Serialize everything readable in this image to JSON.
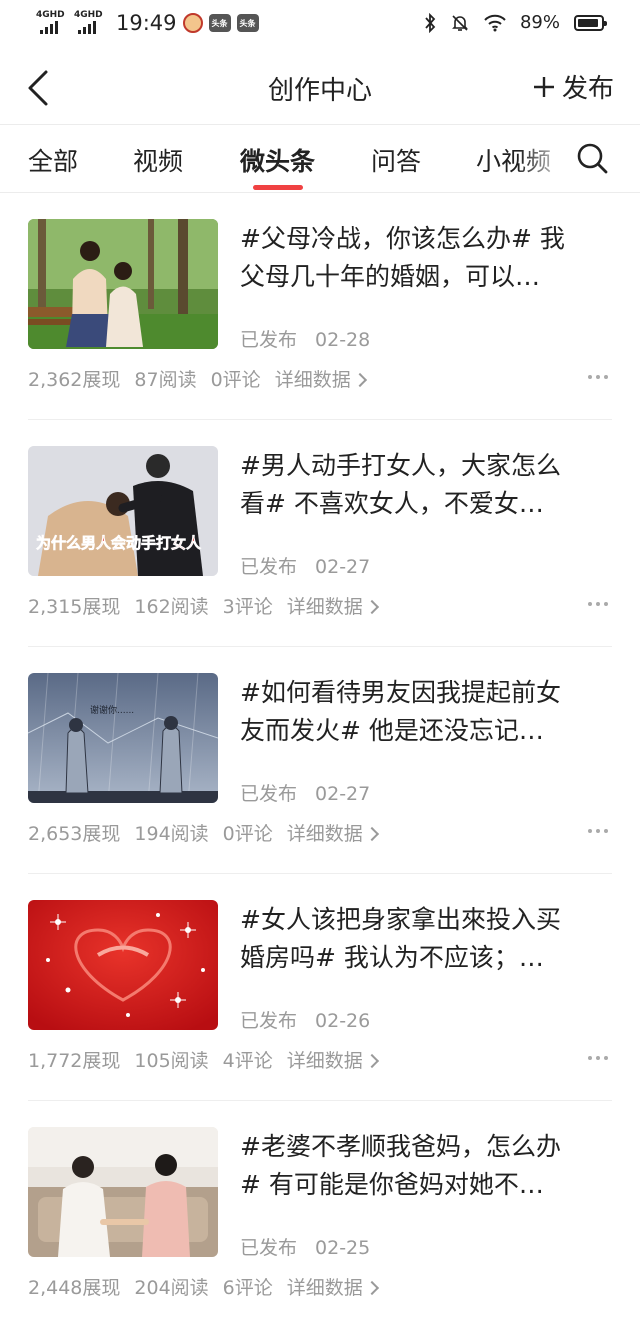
{
  "status_bar": {
    "network1": "4GHD",
    "network2": "4GHD",
    "time": "19:49",
    "app_badge1": "头条",
    "app_badge2": "头条",
    "battery": "89%",
    "battery_level": 0.89,
    "icons": [
      "signal-icon",
      "signal-icon",
      "app-notification-icon",
      "toutiao-icon",
      "toutiao-icon",
      "bluetooth-icon",
      "mute-icon",
      "wifi-icon",
      "battery-icon"
    ]
  },
  "header": {
    "title": "创作中心",
    "publish_label": "发布",
    "icons": [
      "back-icon",
      "plus-icon"
    ]
  },
  "tabs": [
    {
      "label": "全部"
    },
    {
      "label": "视频"
    },
    {
      "label": "微头条"
    },
    {
      "label": "问答"
    },
    {
      "label": "小视频"
    }
  ],
  "active_tab": "微头条",
  "colors": {
    "accent": "#f04142",
    "text": "#222222",
    "muted": "#9a9a9a"
  },
  "posts": [
    {
      "title_line1": "#父母冷战，你该怎么办# 我",
      "title_line2": "父母几十年的婚姻，可以…",
      "status": "已发布",
      "date": "02-28",
      "views": "2,362展现",
      "reads": "87阅读",
      "comments": "0评论",
      "details": "详细数据",
      "image": "mother-daughter-park-photo"
    },
    {
      "title_line1": "#男人动手打女人，大家怎么",
      "title_line2": "看# 不喜欢女人，不爱女…",
      "status": "已发布",
      "date": "02-27",
      "views": "2,315展现",
      "reads": "162阅读",
      "comments": "3评论",
      "details": "详细数据",
      "image": "couple-argument-photo",
      "image_caption": "为什么男人会动手打女人"
    },
    {
      "title_line1": "#如何看待男友因我提起前女",
      "title_line2": "友而发火# 他是还没忘记…",
      "status": "已发布",
      "date": "02-27",
      "views": "2,653展现",
      "reads": "194阅读",
      "comments": "0评论",
      "details": "详细数据",
      "image": "anime-couple-rain-illustration",
      "image_caption": "谢谢你......"
    },
    {
      "title_line1": "#女人该把身家拿出來投入买",
      "title_line2": "婚房吗# 我认为不应该；…",
      "status": "已发布",
      "date": "02-26",
      "views": "1,772展现",
      "reads": "105阅读",
      "comments": "4评论",
      "details": "详细数据",
      "image": "red-heart-sparkle-graphic"
    },
    {
      "title_line1": "#老婆不孝顺我爸妈，怎么办",
      "title_line2": "# 有可能是你爸妈对她不…",
      "status": "已发布",
      "date": "02-25",
      "views": "2,448展现",
      "reads": "204阅读",
      "comments": "6评论",
      "details": "详细数据",
      "image": "mother-in-law-daughter-photo"
    }
  ]
}
